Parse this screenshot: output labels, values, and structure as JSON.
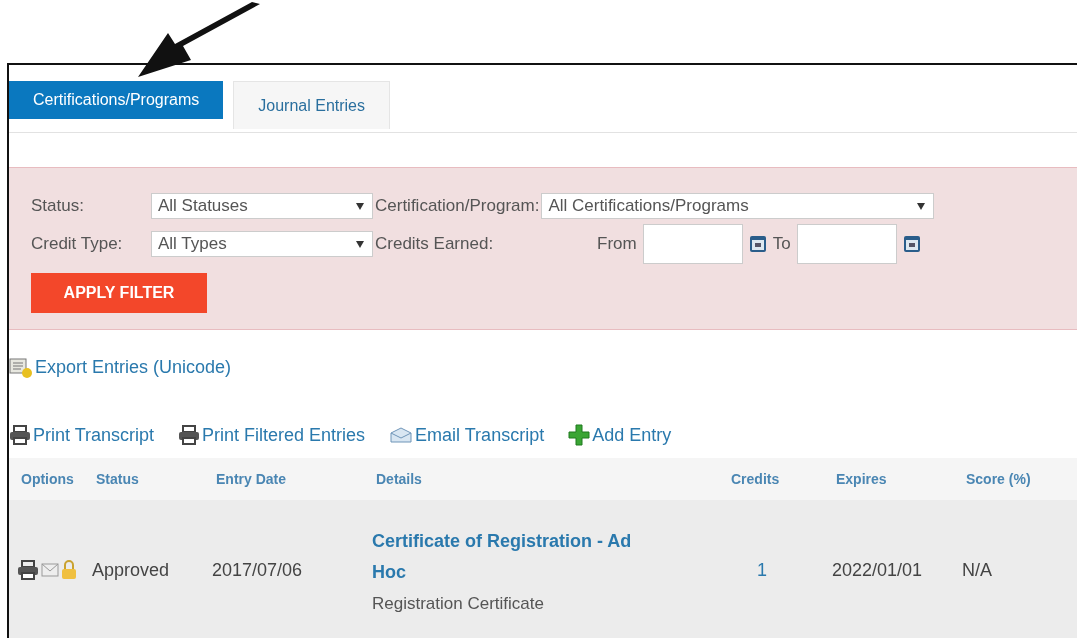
{
  "tabs": [
    {
      "label": "Certifications/Programs",
      "selected": true
    },
    {
      "label": "Journal Entries",
      "selected": false
    }
  ],
  "filters": {
    "status": {
      "label": "Status:",
      "value": "All Statuses"
    },
    "program": {
      "label": "Certification/Program:",
      "value": "All Certifications/Programs"
    },
    "credit_type": {
      "label": "Credit Type:",
      "value": "All Types"
    },
    "credits_earned": {
      "label": "Credits Earned:",
      "from_label": "From",
      "to_label": "To"
    },
    "apply_button": "APPLY FILTER"
  },
  "export_link": "Export Entries (Unicode)",
  "actions": [
    {
      "kind": "print",
      "label": "Print Transcript"
    },
    {
      "kind": "print",
      "label": "Print Filtered Entries"
    },
    {
      "kind": "email",
      "label": "Email Transcript"
    },
    {
      "kind": "add",
      "label": "Add Entry"
    }
  ],
  "table": {
    "columns": [
      "Options",
      "Status",
      "Entry Date",
      "Details",
      "Credits",
      "Expires",
      "Score (%)"
    ],
    "rows": [
      {
        "status": "Approved",
        "entry_date": "2017/07/06",
        "details_title": "Certificate of Registration - Ad Hoc",
        "details_subtitle": "Registration Certificate",
        "credits": "1",
        "expires": "2022/01/01",
        "score": "N/A"
      }
    ]
  }
}
